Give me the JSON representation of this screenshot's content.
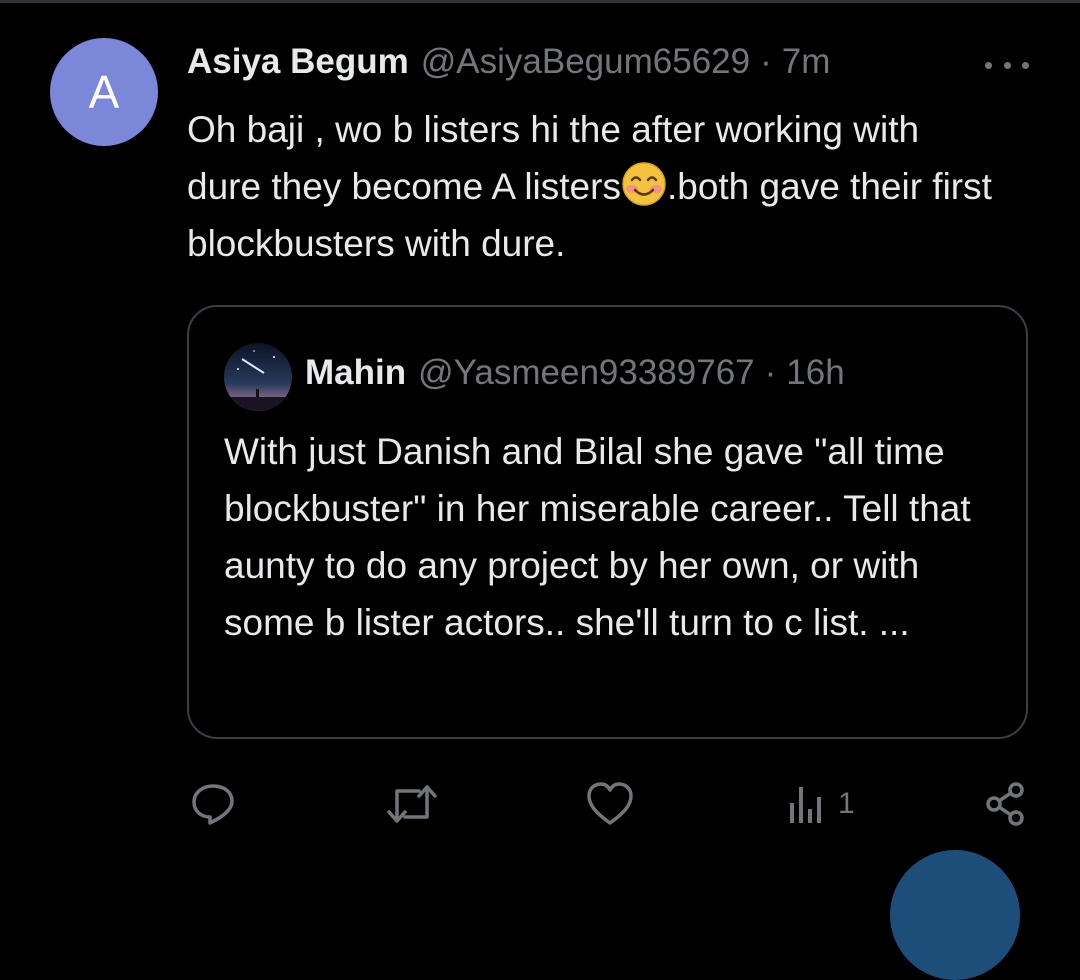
{
  "tweet": {
    "avatar_letter": "A",
    "display_name": "Asiya Begum",
    "handle": "@AsiyaBegum65629",
    "separator": "·",
    "time": "7m",
    "text_part1": "Oh baji , wo b listers hi the after working with dure they become A listers",
    "emoji": "smiling-face-with-smiling-eyes-emoji",
    "text_part2": ".both gave their first blockbusters with dure."
  },
  "quoted": {
    "display_name": "Mahin",
    "handle": "@Yasmeen93389767",
    "separator": "·",
    "time": "16h",
    "text": "With just Danish and Bilal she gave \"all time blockbuster\" in her miserable career.. Tell that aunty to do any project by her own, or with some b lister actors.. she'll turn to c list. ..."
  },
  "actions": {
    "reply_icon": "reply-icon",
    "retweet_icon": "retweet-icon",
    "like_icon": "like-icon",
    "views_icon": "views-icon",
    "views_count": "1",
    "share_icon": "share-icon"
  },
  "colors": {
    "background": "#000000",
    "text": "#e7e9ea",
    "secondary": "#71767b",
    "avatar": "#7b87d9",
    "border": "#3a3f44"
  }
}
